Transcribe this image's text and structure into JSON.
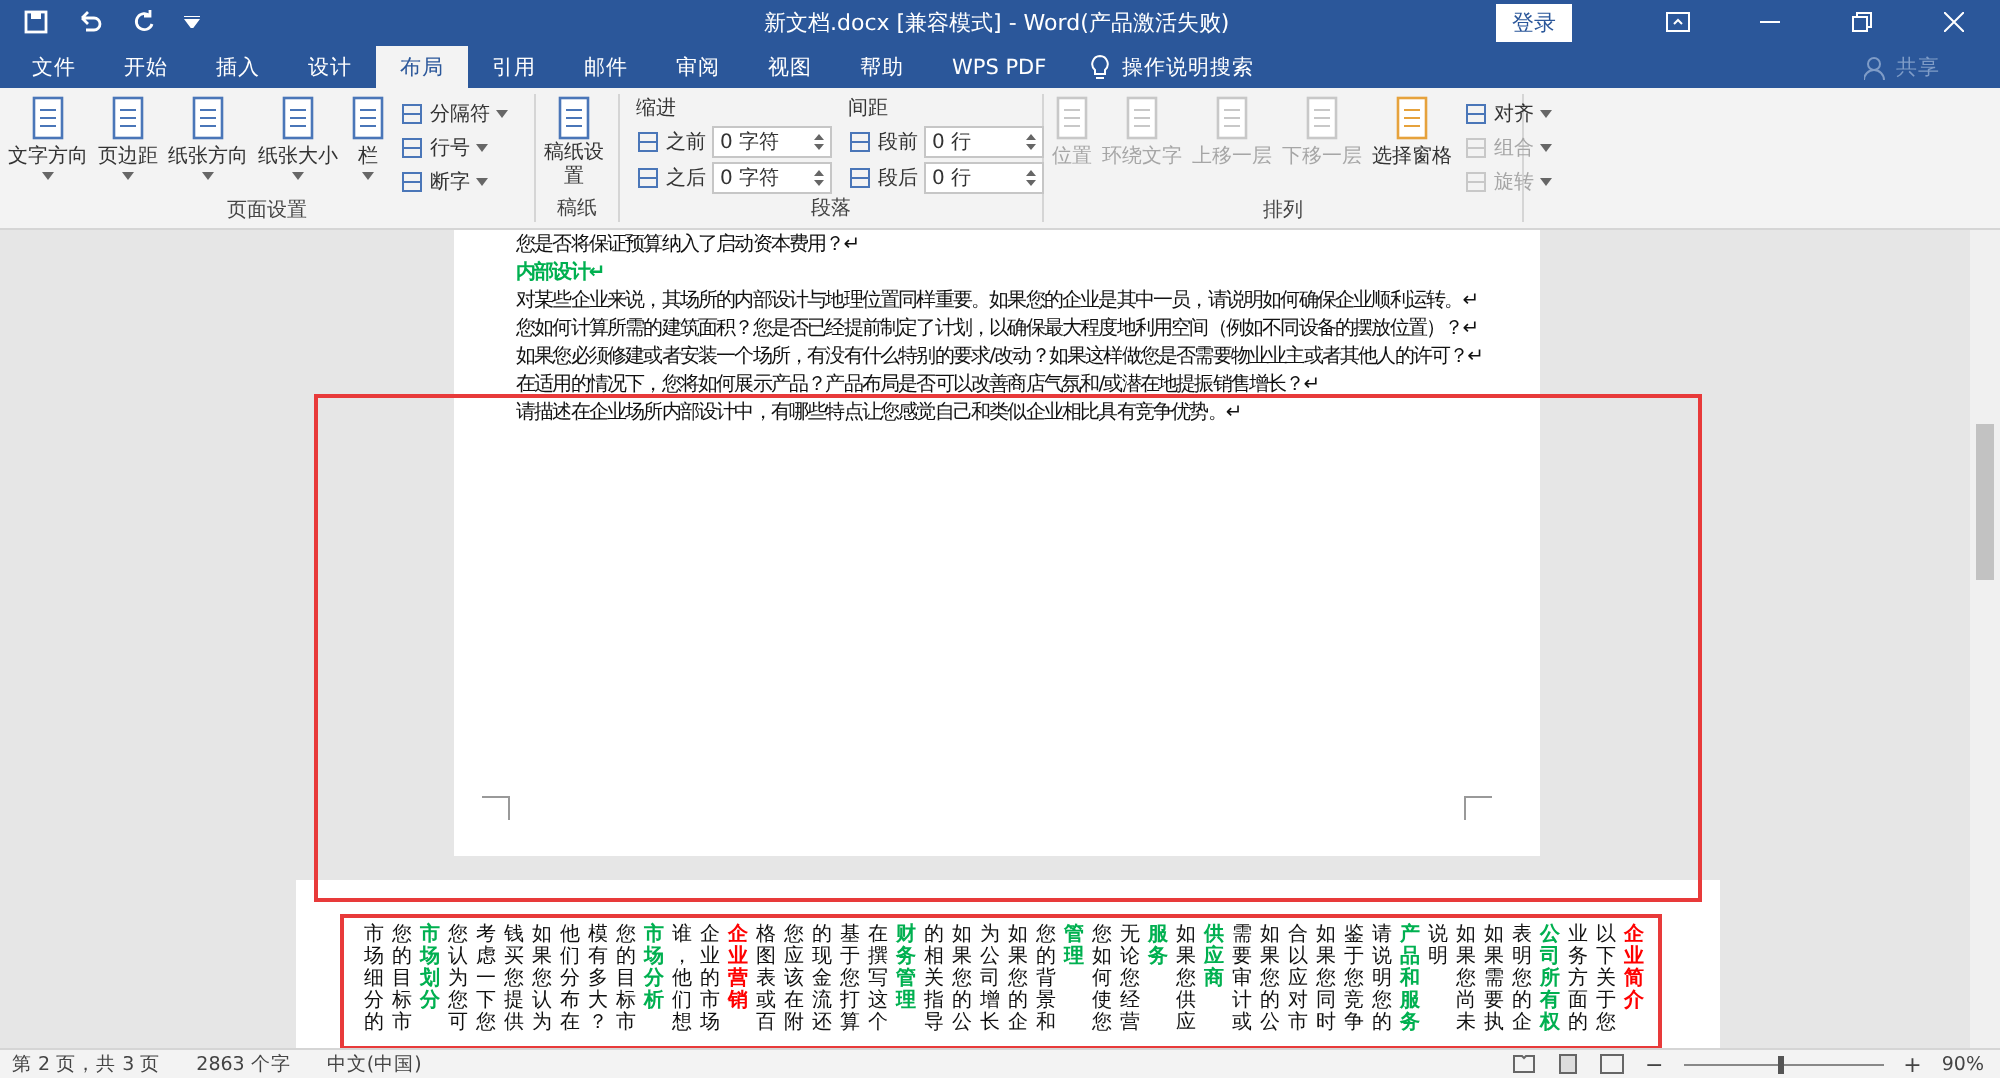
{
  "window": {
    "title": "新文档.docx [兼容模式] - Word(产品激活失败)",
    "login": "登录"
  },
  "tabs": [
    {
      "label": "文件",
      "selected": false
    },
    {
      "label": "开始",
      "selected": false
    },
    {
      "label": "插入",
      "selected": false
    },
    {
      "label": "设计",
      "selected": false
    },
    {
      "label": "布局",
      "selected": true
    },
    {
      "label": "引用",
      "selected": false
    },
    {
      "label": "邮件",
      "selected": false
    },
    {
      "label": "审阅",
      "selected": false
    },
    {
      "label": "视图",
      "selected": false
    },
    {
      "label": "帮助",
      "selected": false
    },
    {
      "label": "WPS PDF",
      "selected": false
    }
  ],
  "search": {
    "placeholder": "操作说明搜索"
  },
  "share": "共享",
  "ribbon": {
    "page_setup": {
      "title": "页面设置",
      "big": [
        "文字方向",
        "页边距",
        "纸张方向",
        "纸张大小",
        "栏"
      ],
      "small": [
        "分隔符",
        "行号",
        "断字"
      ]
    },
    "manuscript": {
      "title": "稿纸",
      "button": "稿纸设置"
    },
    "paragraph": {
      "title": "段落",
      "indent_label": "缩进",
      "spacing_label": "间距",
      "indent": [
        {
          "label": "之前",
          "value": "0 字符"
        },
        {
          "label": "之后",
          "value": "0 字符"
        }
      ],
      "spacing": [
        {
          "label": "段前",
          "value": "0 行"
        },
        {
          "label": "段后",
          "value": "0 行"
        }
      ]
    },
    "arrange": {
      "title": "排列",
      "big": [
        {
          "label": "位置",
          "disabled": true
        },
        {
          "label": "环绕文字",
          "disabled": true
        },
        {
          "label": "上移一层",
          "disabled": true
        },
        {
          "label": "下移一层",
          "disabled": true
        },
        {
          "label": "选择窗格",
          "disabled": false
        }
      ],
      "small": [
        {
          "label": "对齐",
          "disabled": false
        },
        {
          "label": "组合",
          "disabled": true
        },
        {
          "label": "旋转",
          "disabled": true
        }
      ]
    }
  },
  "page1": {
    "paragraphs": [
      {
        "kind": "body",
        "text": "您是否将保证预算纳入了启动资本费用？↵"
      },
      {
        "kind": "heading",
        "text": "内部设计↵"
      },
      {
        "kind": "body",
        "text": "对某些企业来说，其场所的内部设计与地理位置同样重要。如果您的企业是其中一员，请说明如何确保企业顺利运转。↵"
      },
      {
        "kind": "body",
        "text": "您如何计算所需的建筑面积？您是否已经提前制定了计划，以确保最大程度地利用空间（例如不同设备的摆放位置）？↵"
      },
      {
        "kind": "body",
        "text": "如果您必须修建或者安装一个场所，有没有什么特别的要求/改动？如果这样做您是否需要物业业主或者其他人的许可？↵"
      },
      {
        "kind": "body",
        "text": "在适用的情况下，您将如何展示产品？产品布局是否可以改善商店气氛和/或潜在地提振销售增长？↵"
      },
      {
        "kind": "body",
        "text": "请描述在企业场所内部设计中，有哪些特点让您感觉自己和类似企业相比具有竞争优势。↵"
      }
    ]
  },
  "page2": {
    "columns": [
      {
        "kind": "body",
        "text": "市场细分的"
      },
      {
        "kind": "body",
        "text": "您的目标市"
      },
      {
        "kind": "green",
        "text": "市场划分"
      },
      {
        "kind": "body",
        "text": "您认为您可"
      },
      {
        "kind": "body",
        "text": "考虑一下您"
      },
      {
        "kind": "body",
        "text": "钱买您提供"
      },
      {
        "kind": "body",
        "text": "如果您认为"
      },
      {
        "kind": "body",
        "text": "他们分布在"
      },
      {
        "kind": "body",
        "text": "模有多大？"
      },
      {
        "kind": "body",
        "text": "您的目标市"
      },
      {
        "kind": "green",
        "text": "市场分析"
      },
      {
        "kind": "body",
        "text": "谁，他们想"
      },
      {
        "kind": "body",
        "text": "企业的市场"
      },
      {
        "kind": "red",
        "text": "企业营销"
      },
      {
        "kind": "body",
        "text": "格图表或百"
      },
      {
        "kind": "body",
        "text": "您应该在附"
      },
      {
        "kind": "body",
        "text": "的现金流还"
      },
      {
        "kind": "body",
        "text": "基于您打算"
      },
      {
        "kind": "body",
        "text": "在撰写这个"
      },
      {
        "kind": "green",
        "text": "财务管理"
      },
      {
        "kind": "body",
        "text": "的相关指导"
      },
      {
        "kind": "body",
        "text": "如果您的公"
      },
      {
        "kind": "body",
        "text": "为公司增长"
      },
      {
        "kind": "body",
        "text": "如果您的企"
      },
      {
        "kind": "body",
        "text": "您的背景和"
      },
      {
        "kind": "green",
        "text": "管理"
      },
      {
        "kind": "body",
        "text": "您如何使您"
      },
      {
        "kind": "body",
        "text": "无论您经营"
      },
      {
        "kind": "green",
        "text": "服务"
      },
      {
        "kind": "body",
        "text": "如果您供应"
      },
      {
        "kind": "green",
        "text": "供应商"
      },
      {
        "kind": "body",
        "text": "需要审计或"
      },
      {
        "kind": "body",
        "text": "如果您的公"
      },
      {
        "kind": "body",
        "text": "合以应对市"
      },
      {
        "kind": "body",
        "text": "如果您同时"
      },
      {
        "kind": "body",
        "text": "鉴于您竞争"
      },
      {
        "kind": "body",
        "text": "请说明您的"
      },
      {
        "kind": "green",
        "text": "产品和服务"
      },
      {
        "kind": "body",
        "text": "说明"
      },
      {
        "kind": "body",
        "text": "如果您尚未"
      },
      {
        "kind": "body",
        "text": "如果需要执"
      },
      {
        "kind": "body",
        "text": "表明您的企"
      },
      {
        "kind": "green",
        "text": "公司所有权"
      },
      {
        "kind": "body",
        "text": "业务方面的"
      },
      {
        "kind": "body",
        "text": "以下关于您"
      },
      {
        "kind": "red",
        "text": "企业简介"
      }
    ]
  },
  "status_bar": {
    "page": "第 2 页，共 3 页",
    "words": "2863 个字",
    "language": "中文(中国)",
    "zoom_out": "−",
    "zoom_in": "+",
    "zoom": "90%",
    "level": 0.47
  }
}
